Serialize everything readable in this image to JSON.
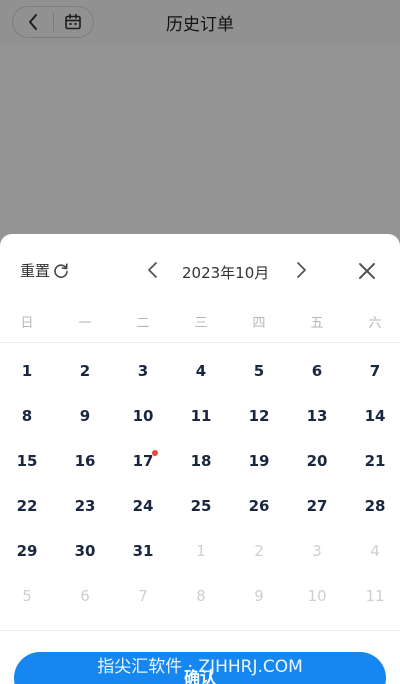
{
  "header": {
    "title": "历史订单"
  },
  "calendar": {
    "reset_label": "重置",
    "month_label": "2023年10月",
    "weekdays": [
      "日",
      "一",
      "二",
      "三",
      "四",
      "五",
      "六"
    ],
    "weeks": [
      [
        {
          "d": "1"
        },
        {
          "d": "2"
        },
        {
          "d": "3"
        },
        {
          "d": "4"
        },
        {
          "d": "5"
        },
        {
          "d": "6"
        },
        {
          "d": "7"
        }
      ],
      [
        {
          "d": "8"
        },
        {
          "d": "9"
        },
        {
          "d": "10"
        },
        {
          "d": "11"
        },
        {
          "d": "12"
        },
        {
          "d": "13"
        },
        {
          "d": "14"
        }
      ],
      [
        {
          "d": "15"
        },
        {
          "d": "16"
        },
        {
          "d": "17",
          "marked": true
        },
        {
          "d": "18"
        },
        {
          "d": "19"
        },
        {
          "d": "20"
        },
        {
          "d": "21"
        }
      ],
      [
        {
          "d": "22"
        },
        {
          "d": "23"
        },
        {
          "d": "24"
        },
        {
          "d": "25"
        },
        {
          "d": "26"
        },
        {
          "d": "27"
        },
        {
          "d": "28"
        }
      ],
      [
        {
          "d": "29"
        },
        {
          "d": "30"
        },
        {
          "d": "31"
        },
        {
          "d": "1",
          "muted": true
        },
        {
          "d": "2",
          "muted": true
        },
        {
          "d": "3",
          "muted": true
        },
        {
          "d": "4",
          "muted": true
        }
      ],
      [
        {
          "d": "5",
          "muted": true
        },
        {
          "d": "6",
          "muted": true
        },
        {
          "d": "7",
          "muted": true
        },
        {
          "d": "8",
          "muted": true
        },
        {
          "d": "9",
          "muted": true
        },
        {
          "d": "10",
          "muted": true
        },
        {
          "d": "11",
          "muted": true
        }
      ]
    ],
    "marker_color": "#f0433a"
  },
  "confirm_label": "确认",
  "watermark": "指尖汇软件 · ZJHHRJ.COM",
  "colors": {
    "accent": "#1687f0",
    "day_text": "#1a2740",
    "muted_text": "#cfcfcf"
  }
}
